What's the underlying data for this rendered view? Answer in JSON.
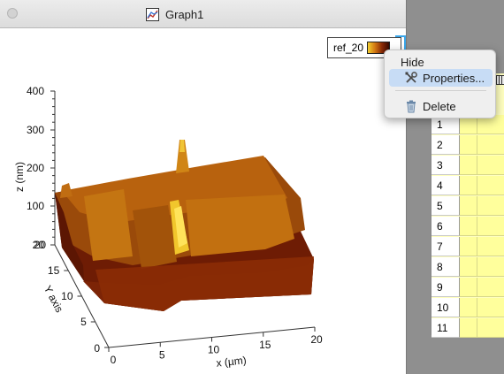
{
  "window": {
    "title": "Graph1"
  },
  "legend": {
    "label": "ref_20"
  },
  "context_menu": {
    "items": [
      {
        "label": "Hide",
        "icon": ""
      },
      {
        "label": "Properties...",
        "icon": "wrench-screwdriver-icon",
        "highlighted": true
      },
      {
        "label": "Delete",
        "icon": "trash-icon"
      }
    ]
  },
  "sheet": {
    "row_numbers": [
      "1",
      "2",
      "3",
      "4",
      "5",
      "6",
      "7",
      "8",
      "9",
      "10",
      "11"
    ]
  },
  "chart_data": {
    "type": "surface",
    "xlabel": "x (µm)",
    "ylabel": "Y axis",
    "zlabel": "z (nm)",
    "x_ticks": [
      "0",
      "5",
      "10",
      "15",
      "20"
    ],
    "y_ticks": [
      "0",
      "5",
      "10",
      "15",
      "20"
    ],
    "z_ticks": [
      "20",
      "100",
      "200",
      "300",
      "400"
    ],
    "xlim": [
      0,
      20
    ],
    "ylim": [
      0,
      20
    ],
    "zlim": [
      20,
      400
    ],
    "colormap": [
      "#f4d030",
      "#d27812",
      "#8a2a06",
      "#3a0a00"
    ]
  }
}
